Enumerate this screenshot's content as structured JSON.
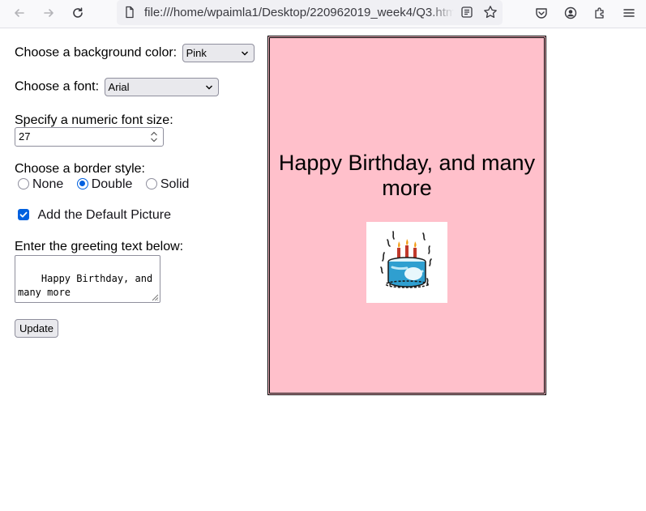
{
  "browser": {
    "url": "file:///home/wpaimla1/Desktop/220962019_week4/Q3.html"
  },
  "form": {
    "bg_label": "Choose a background color:",
    "bg_value": "Pink",
    "font_label": "Choose a font:",
    "font_value": "Arial",
    "size_label": "Specify a numeric font size:",
    "size_value": "27",
    "border_label": "Choose a border style:",
    "border_options": [
      {
        "label": "None",
        "checked": false
      },
      {
        "label": "Double",
        "checked": true
      },
      {
        "label": "Solid",
        "checked": false
      }
    ],
    "picture_label": "Add the Default Picture",
    "picture_checked": true,
    "greeting_label": "Enter the greeting text below:",
    "greeting_value": "Happy Birthday, and\nmany more",
    "update_label": "Update"
  },
  "card": {
    "text": "Happy Birthday, and many more",
    "background_color": "#ffc0cb",
    "border_style": "double",
    "picture_icon": "birthday-cake"
  },
  "colors": {
    "accent": "#0060df"
  }
}
